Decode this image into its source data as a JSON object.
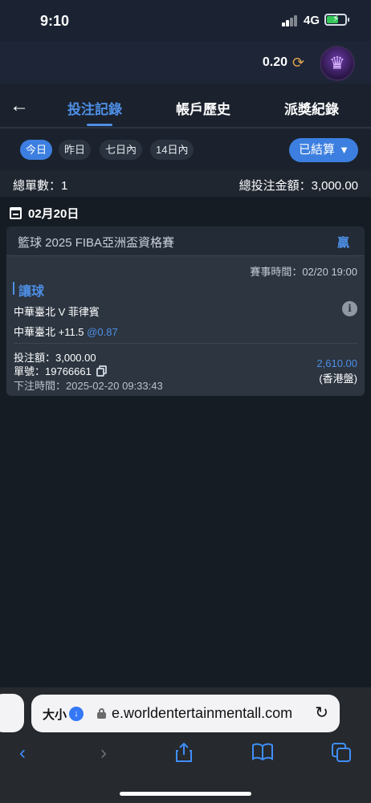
{
  "status_bar": {
    "time": "9:10",
    "network": "4G"
  },
  "header": {
    "balance": "0.20"
  },
  "tabs": [
    {
      "label": "投注記錄",
      "active": true
    },
    {
      "label": "帳戶歷史",
      "active": false
    },
    {
      "label": "派獎紀錄",
      "active": false
    }
  ],
  "filters": {
    "chips": [
      {
        "label": "今日",
        "active": true
      },
      {
        "label": "昨日",
        "active": false
      },
      {
        "label": "七日內",
        "active": false
      },
      {
        "label": "14日內",
        "active": false
      }
    ],
    "status_dropdown": "已結算"
  },
  "summary": {
    "total_orders": "總單數：1",
    "total_stake": "總投注金額：3,000.00"
  },
  "date_group": {
    "date": "02月20日"
  },
  "bet": {
    "league": "籃球 2025 FIBA亞洲盃資格賽",
    "result": "贏",
    "match_time": "賽事時間：02/20 19:00",
    "market": "讓球",
    "matchup": "中華臺北 V 菲律賓",
    "selection": "中華臺北 +11.5",
    "odds": "@0.87",
    "stake": "投注額：3,000.00",
    "ticket": "單號：19766661",
    "placed_time": "下注時間：2025-02-20 09:33:43",
    "payout": "2,610.00",
    "odds_type": "(香港盤)"
  },
  "browser": {
    "size_label": "大小",
    "url": "e.worldentertainmentall.com"
  },
  "colors": {
    "accent": "#4e8fe6",
    "chip_active": "#3d7fe0",
    "background": "#161c24",
    "card": "#2c3540"
  }
}
